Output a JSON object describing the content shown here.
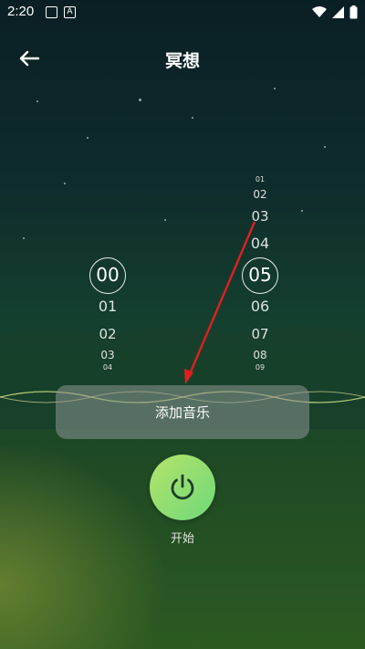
{
  "status_bar": {
    "time": "2:20"
  },
  "header": {
    "title": "冥想",
    "back_icon": "arrow-left-icon"
  },
  "picker_left": {
    "selected": "00",
    "below": [
      "01",
      "02",
      "03",
      "04"
    ]
  },
  "picker_right": {
    "above": [
      "01",
      "02",
      "03",
      "04"
    ],
    "selected": "05",
    "below": [
      "06",
      "07",
      "08",
      "09"
    ]
  },
  "add_music": {
    "label": "添加音乐"
  },
  "start": {
    "label": "开始",
    "icon": "power-icon"
  },
  "colors": {
    "accent_start": "#b5e36a",
    "accent_end": "#6fd97a",
    "annotation_arrow": "#e02020"
  }
}
